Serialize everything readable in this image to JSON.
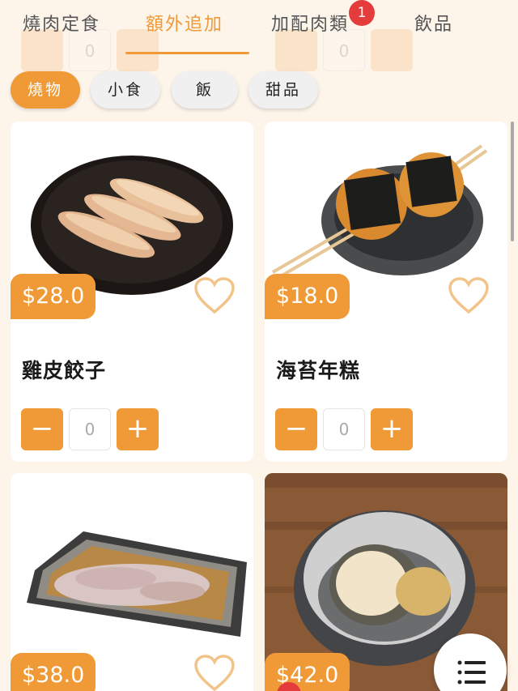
{
  "tabs": [
    {
      "label": "燒肉定食"
    },
    {
      "label": "額外追加"
    },
    {
      "label": "加配肉類",
      "badge": "1"
    },
    {
      "label": "飲品"
    }
  ],
  "ghost_qty": "0",
  "chips": [
    {
      "label": "燒物"
    },
    {
      "label": "小食"
    },
    {
      "label": "飯"
    },
    {
      "label": "甜品"
    }
  ],
  "items": [
    {
      "name": "雞皮餃子",
      "price": "$28.0",
      "qty": "0"
    },
    {
      "name": "海苔年糕",
      "price": "$18.0",
      "qty": "0"
    },
    {
      "name": "",
      "price": "$38.0",
      "qty": ""
    },
    {
      "name": "",
      "price": "$42.0",
      "qty": ""
    }
  ],
  "colors": {
    "accent": "#ef9a36",
    "badge": "#e43c3c",
    "background": "#fdf4ea"
  },
  "icons": {
    "heart": "heart-outline-icon",
    "menu": "list-menu-icon",
    "minus": "minus-icon",
    "plus": "plus-icon"
  }
}
